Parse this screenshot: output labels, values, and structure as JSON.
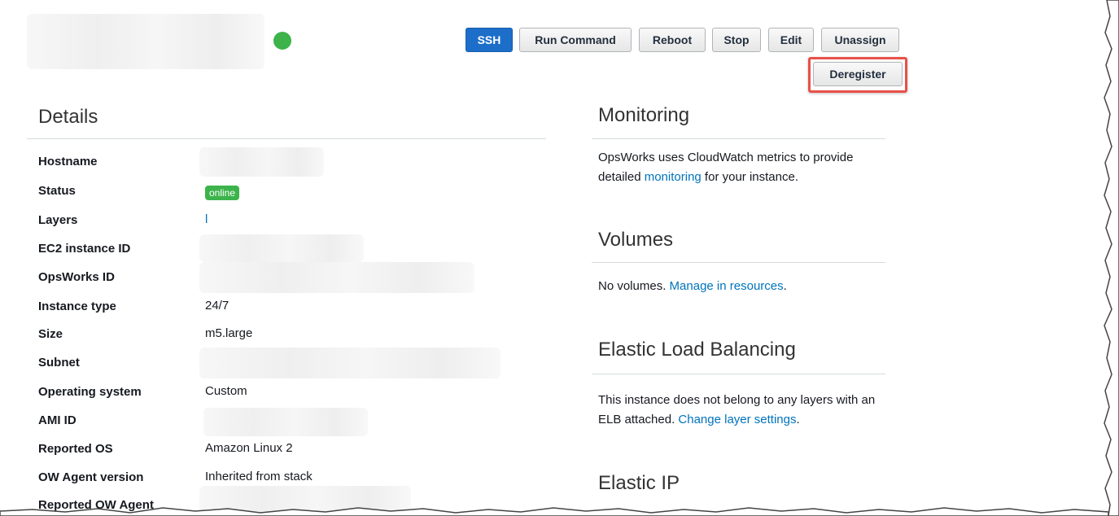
{
  "toolbar": {
    "ssh": "SSH",
    "run_command": "Run Command",
    "reboot": "Reboot",
    "stop": "Stop",
    "edit": "Edit",
    "unassign": "Unassign",
    "deregister": "Deregister"
  },
  "details": {
    "title": "Details",
    "rows": [
      {
        "label": "Hostname",
        "value": ""
      },
      {
        "label": "Status",
        "value": "online"
      },
      {
        "label": "Layers",
        "value": "l"
      },
      {
        "label": "EC2 instance ID",
        "value": ""
      },
      {
        "label": "OpsWorks ID",
        "value": ""
      },
      {
        "label": "Instance type",
        "value": "24/7"
      },
      {
        "label": "Size",
        "value": "m5.large"
      },
      {
        "label": "Subnet",
        "value": ""
      },
      {
        "label": "Operating system",
        "value": "Custom"
      },
      {
        "label": "AMI ID",
        "value": ""
      },
      {
        "label": "Reported OS",
        "value": "Amazon Linux 2"
      },
      {
        "label": "OW Agent version",
        "value": "Inherited from stack"
      },
      {
        "label": "Reported OW Agent",
        "value": ""
      }
    ]
  },
  "monitoring": {
    "title": "Monitoring",
    "text_before": "OpsWorks uses CloudWatch metrics to provide detailed ",
    "link": "monitoring",
    "text_after": " for your instance."
  },
  "volumes": {
    "title": "Volumes",
    "text_before": "No volumes. ",
    "link": "Manage in resources",
    "text_after": "."
  },
  "elb": {
    "title": "Elastic Load Balancing",
    "text_before": "This instance does not belong to any layers with an ELB attached. ",
    "link": "Change layer settings",
    "text_after": "."
  },
  "eip": {
    "title": "Elastic IP"
  },
  "colors": {
    "primary_button": "#1d6ec9",
    "status_online": "#3cb34b",
    "link": "#0073bb",
    "highlight": "#e8514a"
  }
}
